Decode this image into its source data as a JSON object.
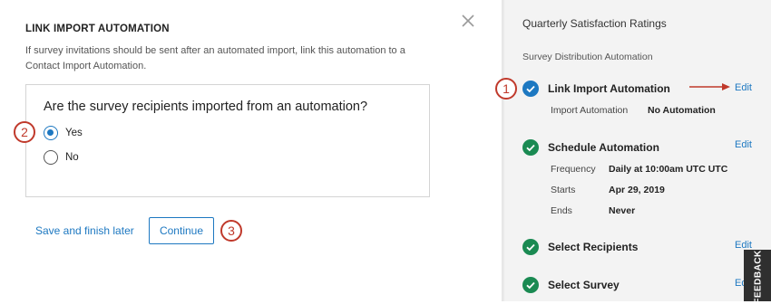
{
  "modal": {
    "heading": "LINK IMPORT AUTOMATION",
    "description": "If survey invitations should be sent after an automated import, link this automation to a Contact Import Automation.",
    "question": "Are the survey recipients imported from an automation?",
    "options": [
      {
        "label": "Yes",
        "checked": true
      },
      {
        "label": "No",
        "checked": false
      }
    ],
    "save_label": "Save and finish later",
    "continue_label": "Continue",
    "close_icon": "close-icon"
  },
  "sidebar": {
    "title": "Quarterly Satisfaction Ratings",
    "subtitle": "Survey Distribution Automation",
    "steps": [
      {
        "title": "Link Import Automation",
        "status": "current",
        "edit_label": "Edit",
        "details": [
          {
            "label": "Import Automation",
            "value": "No Automation"
          }
        ]
      },
      {
        "title": "Schedule Automation",
        "status": "complete",
        "edit_label": "Edit",
        "details": [
          {
            "label": "Frequency",
            "value": "Daily at 10:00am UTC UTC"
          },
          {
            "label": "Starts",
            "value": "Apr 29, 2019"
          },
          {
            "label": "Ends",
            "value": "Never"
          }
        ]
      },
      {
        "title": "Select Recipients",
        "status": "complete",
        "edit_label": "Edit"
      },
      {
        "title": "Select Survey",
        "status": "complete",
        "edit_label": "Edit"
      }
    ]
  },
  "callouts": [
    "1",
    "2",
    "3"
  ],
  "feedback_label": "FEEDBACK",
  "colors": {
    "accent": "#1d78c1",
    "complete": "#1a8a52",
    "callout": "#c0392b",
    "sidebar_bg": "#f3f3f3"
  }
}
